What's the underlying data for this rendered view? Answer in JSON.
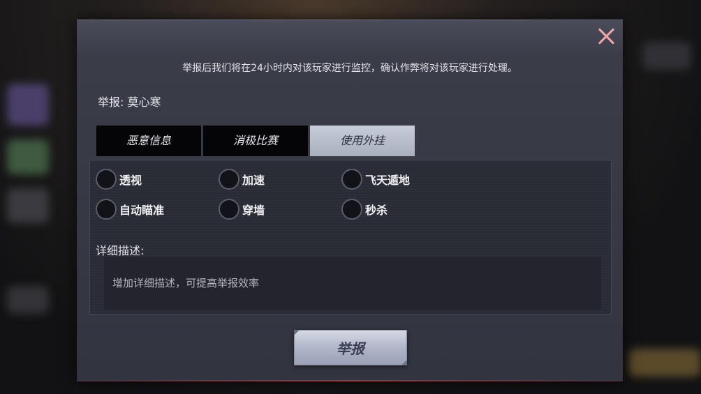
{
  "dialog": {
    "notice": "举报后我们将在24小时内对该玩家进行监控，确认作弊将对该玩家进行处理。",
    "report_target": "举报: 莫心寒",
    "close_icon": "close-icon",
    "tabs": [
      {
        "label": "恶意信息",
        "active": false
      },
      {
        "label": "消极比赛",
        "active": false
      },
      {
        "label": "使用外挂",
        "active": true
      }
    ],
    "options": [
      {
        "label": "透视",
        "selected": false
      },
      {
        "label": "加速",
        "selected": false
      },
      {
        "label": "飞天遁地",
        "selected": false
      },
      {
        "label": "自动瞄准",
        "selected": false
      },
      {
        "label": "穿墙",
        "selected": false
      },
      {
        "label": "秒杀",
        "selected": false
      }
    ],
    "description_label": "详细描述:",
    "description_placeholder": "增加详细描述，可提高举报效率",
    "description_value": "",
    "submit_label": "举报"
  },
  "colors": {
    "dialog_bg": "#353742",
    "tab_active_bg": "#b8bfcc",
    "tab_inactive_bg": "#050507",
    "close_icon": "#f2a8a8",
    "submit_bg": "#b9bdd0"
  }
}
